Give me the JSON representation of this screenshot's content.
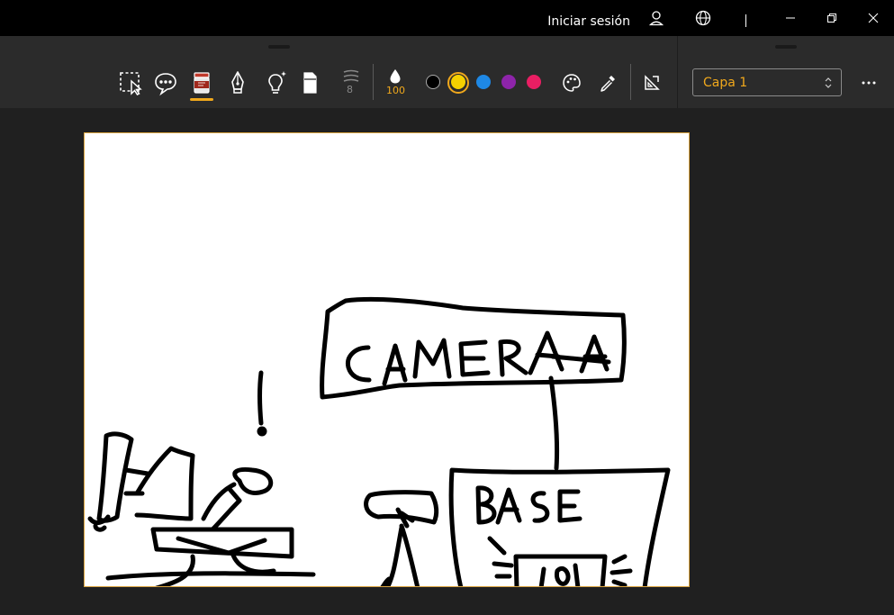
{
  "titlebar": {
    "signin_label": "Iniciar sesión"
  },
  "toolbar": {
    "tools": [
      {
        "name": "selection",
        "icon": "selection-icon"
      },
      {
        "name": "comment",
        "icon": "comment-icon"
      },
      {
        "name": "paint-bucket",
        "icon": "paint-bucket-icon",
        "active": true
      },
      {
        "name": "pen",
        "icon": "pen-icon"
      },
      {
        "name": "magic-lightbulb",
        "icon": "lightbulb-icon"
      },
      {
        "name": "eraser",
        "icon": "eraser-icon"
      }
    ],
    "brush_size": "8",
    "opacity": "100",
    "colors": [
      "#000000",
      "#f5d000",
      "#1e88e5",
      "#8e24aa",
      "#e91e63"
    ],
    "selected_color": "#f5d000",
    "accent_color": "#f0a81c",
    "layer": {
      "value": "Capa 1"
    }
  },
  "canvas": {
    "drawing_text": [
      "CAMERA",
      "BASE"
    ]
  }
}
